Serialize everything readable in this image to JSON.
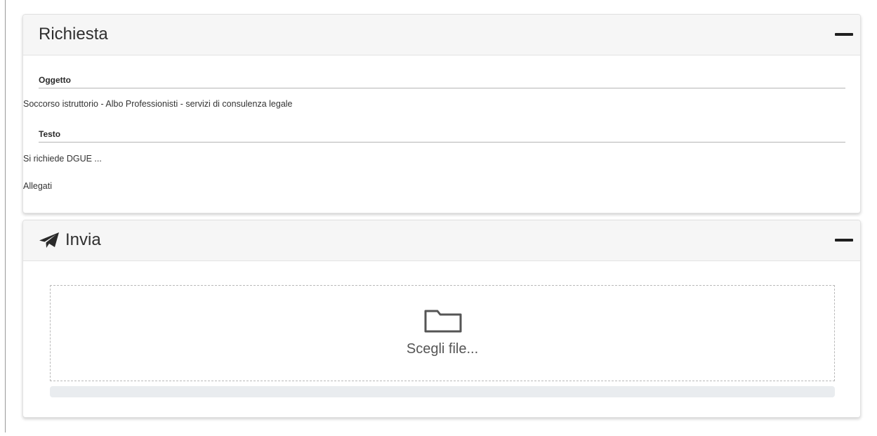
{
  "richiesta": {
    "title": "Richiesta",
    "fields": [
      {
        "label": "Oggetto",
        "value": "Soccorso istruttorio - Albo Professionisti - servizi di consulenza legale"
      },
      {
        "label": "Testo",
        "value": "Si richiede DGUE ..."
      }
    ],
    "attachments_label": "Allegati"
  },
  "invia": {
    "title": "Invia",
    "title_icon": "paper-plane-icon",
    "dropzone": {
      "icon": "folder-icon",
      "label": "Scegli file..."
    },
    "upload_progress": 0
  },
  "colors": {
    "panel_header_bg": "#f6f6f6",
    "progress_track": "#e9ecef"
  }
}
